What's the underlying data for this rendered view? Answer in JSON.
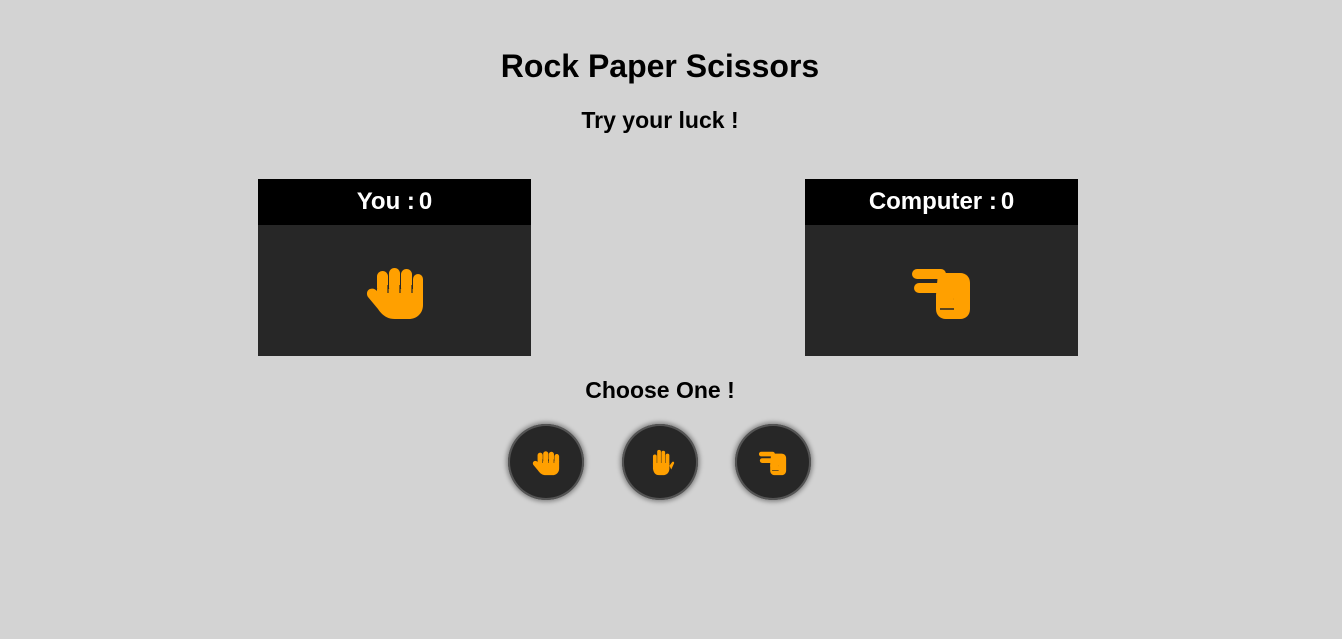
{
  "header": {
    "title": "Rock Paper Scissors",
    "subtitle": "Try your luck !"
  },
  "player": {
    "label": "You :",
    "score": "0",
    "current_hand": "fist-icon"
  },
  "computer": {
    "label": "Computer :",
    "score": "0",
    "current_hand": "scissors-hand-icon"
  },
  "choices": {
    "prompt": "Choose One !",
    "options": [
      {
        "id": "rock",
        "icon": "fist-icon"
      },
      {
        "id": "paper",
        "icon": "open-hand-icon"
      },
      {
        "id": "scissors",
        "icon": "scissors-hand-icon"
      }
    ]
  },
  "colors": {
    "background": "#d3d3d3",
    "panel": "#272727",
    "panel_header": "#000000",
    "accent": "#ffa000"
  }
}
